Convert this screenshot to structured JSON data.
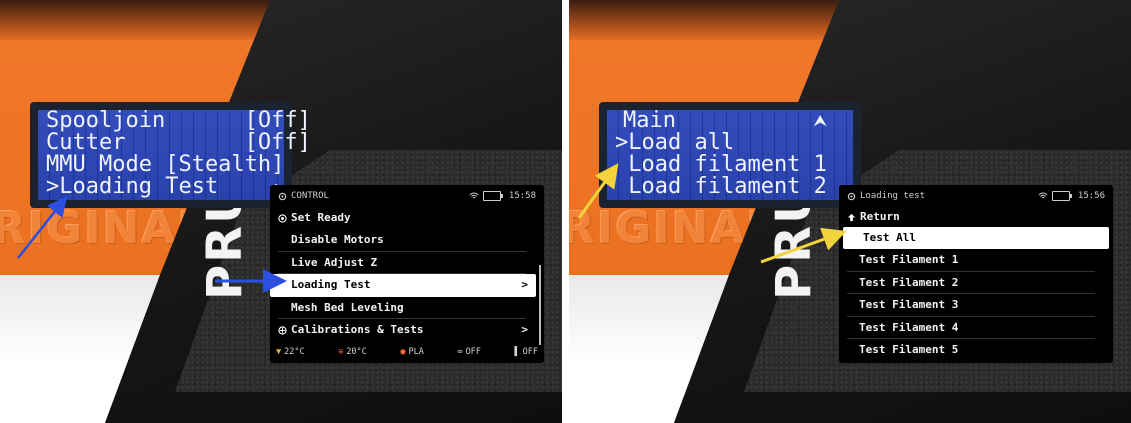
{
  "left": {
    "lcd_lines": [
      "Spooljoin      [Off]",
      "Cutter         [Off]",
      "MMU Mode [Stealth]",
      ">Loading Test     "
    ],
    "lcd_arrow_glyph": "➔",
    "engraving_text": "RIGINAL PRUS",
    "vertical_logo_text": "PRU",
    "screen": {
      "header_title": "CONTROL",
      "time": "15:58",
      "menu_items": [
        {
          "label": "Set Ready",
          "chevron": ""
        },
        {
          "label": "Disable Motors",
          "chevron": ""
        },
        {
          "label": "Live Adjust Z",
          "chevron": ""
        },
        {
          "label": "Loading Test",
          "chevron": ">"
        },
        {
          "label": "Mesh Bed Leveling",
          "chevron": ""
        },
        {
          "label": "Calibrations & Tests",
          "chevron": ">"
        }
      ],
      "footer": {
        "nozzle_temp": "22°C",
        "bed_temp": "20°C",
        "filament": "PLA",
        "mmu": "OFF",
        "fsensor": "OFF"
      }
    },
    "arrow_color": "#2b4fe0"
  },
  "right": {
    "lcd_lines": [
      "Main",
      ">Load all",
      " Load filament 1",
      " Load filament 2"
    ],
    "lcd_home_glyph": "⮝",
    "engraving_text": "RIGINAL PRUS",
    "vertical_logo_text": "PRU",
    "screen": {
      "header_title": "Loading test",
      "time": "15:56",
      "return_label": "Return",
      "menu_items": [
        {
          "label": "Test All"
        },
        {
          "label": "Test Filament 1"
        },
        {
          "label": "Test Filament 2"
        },
        {
          "label": "Test Filament 3"
        },
        {
          "label": "Test Filament 4"
        },
        {
          "label": "Test Filament 5"
        }
      ]
    },
    "arrow_color": "#f2d43a"
  },
  "icons": {
    "header_icon": "gear-icon",
    "wifi_icon": "wifi-icon",
    "battery_icon": "battery-icon",
    "return_icon": "return-arrow-icon"
  }
}
